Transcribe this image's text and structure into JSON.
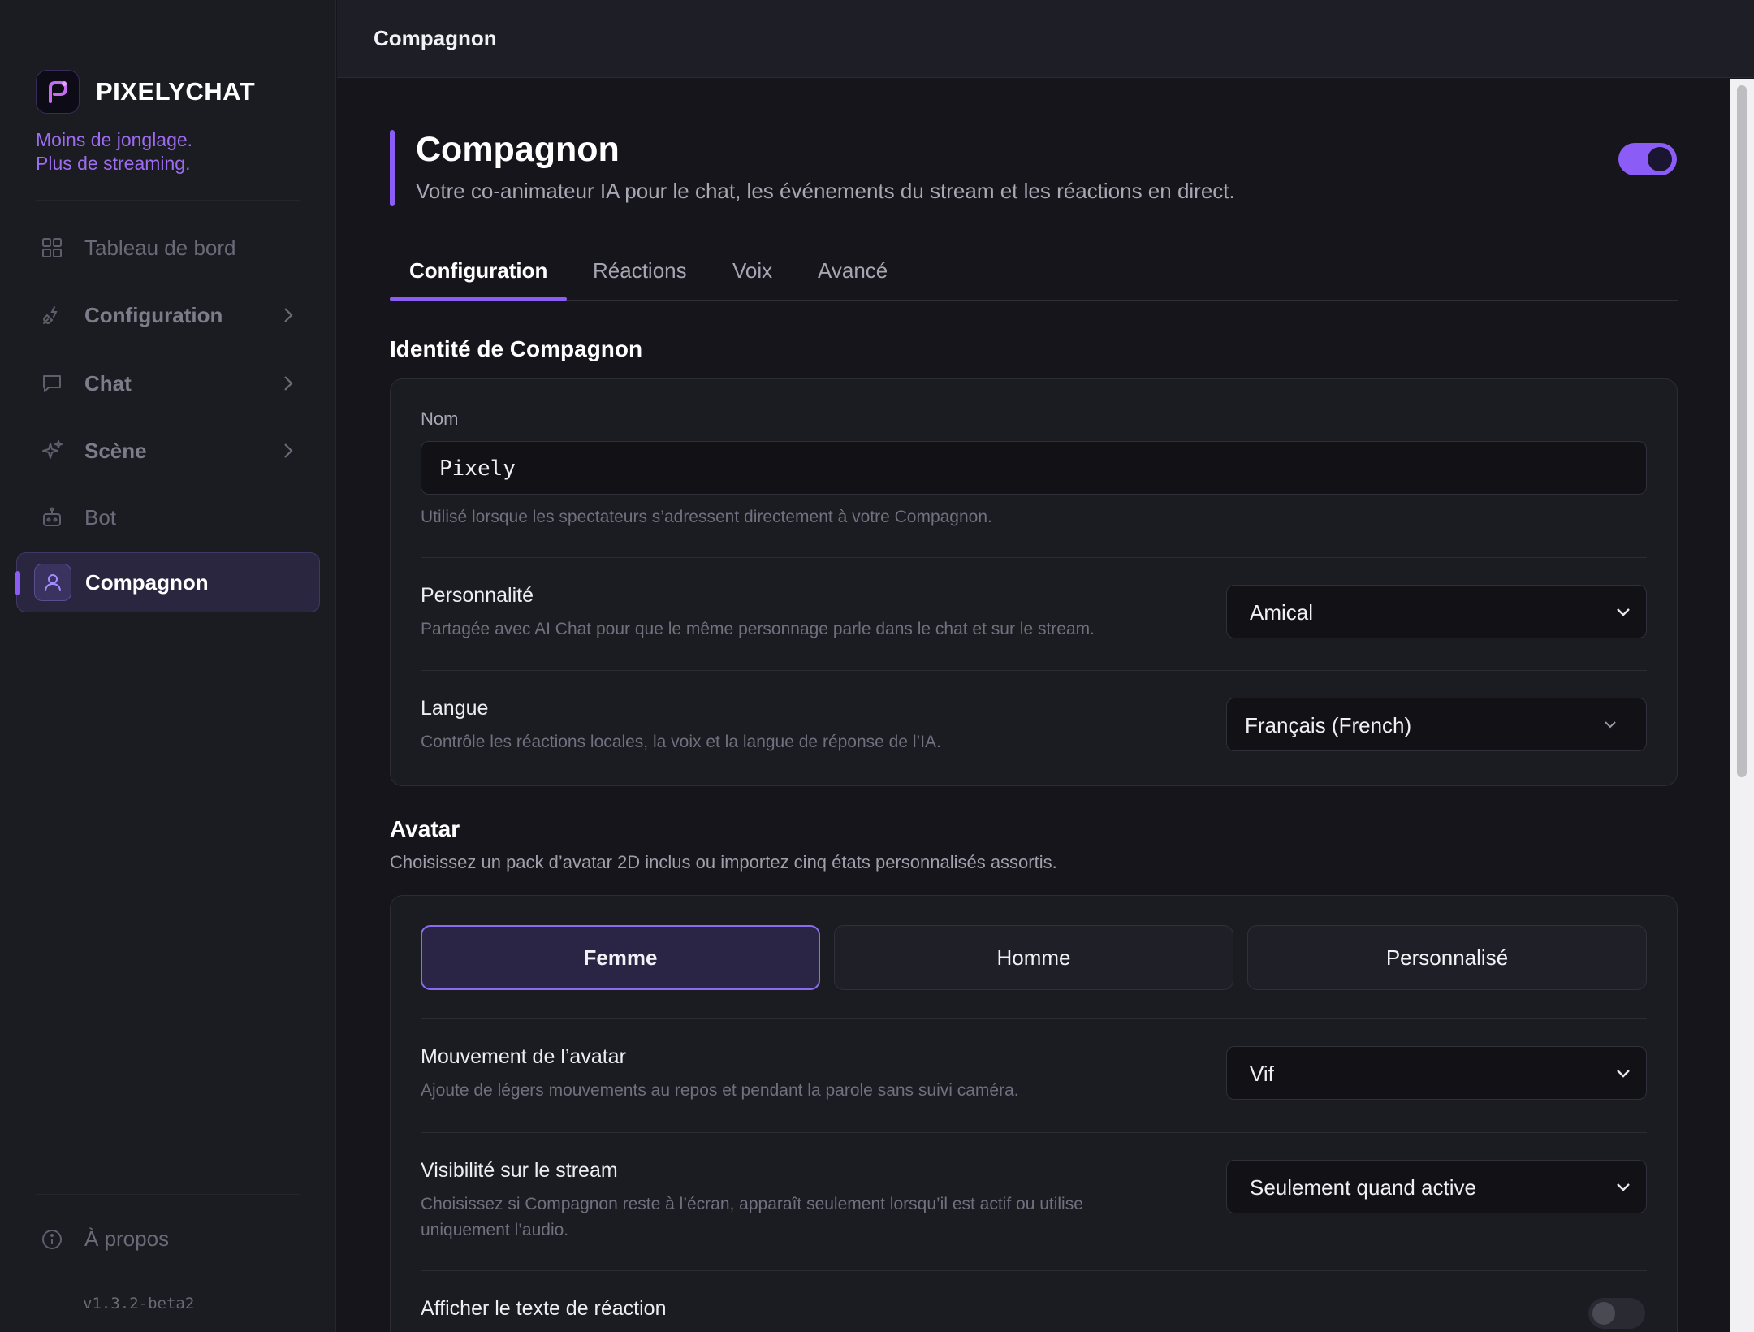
{
  "sidebar": {
    "brand": "PIXELYCHAT",
    "tagline_1": "Moins de jonglage.",
    "tagline_2": "Plus de streaming.",
    "items": [
      {
        "label": "Tableau de bord",
        "icon": "grid-icon"
      },
      {
        "label": "Configuration",
        "icon": "plug-icon",
        "has_children": true
      },
      {
        "label": "Chat",
        "icon": "chat-bubble-icon",
        "has_children": true
      },
      {
        "label": "Scène",
        "icon": "sparkle-icon",
        "has_children": true
      },
      {
        "label": "Bot",
        "icon": "robot-icon"
      },
      {
        "label": "Compagnon",
        "icon": "user-icon",
        "active": true
      }
    ],
    "about": "À propos",
    "version": "v1.3.2-beta2"
  },
  "topbar": {
    "title": "Compagnon"
  },
  "header": {
    "title": "Compagnon",
    "subtitle": "Votre co-animateur IA pour le chat, les événements du stream et les réactions en direct.",
    "enabled": true
  },
  "tabs": [
    {
      "label": "Configuration",
      "active": true
    },
    {
      "label": "Réactions"
    },
    {
      "label": "Voix"
    },
    {
      "label": "Avancé"
    }
  ],
  "identity": {
    "title": "Identité de Compagnon",
    "name_label": "Nom",
    "name_value": "Pixely",
    "name_help": "Utilisé lorsque les spectateurs s’adressent directement à votre Compagnon.",
    "personality_label": "Personnalité",
    "personality_help": "Partagée avec AI Chat pour que le même personnage parle dans le chat et sur le stream.",
    "personality_value": "Amical",
    "language_label": "Langue",
    "language_help": "Contrôle les réactions locales, la voix et la langue de réponse de l’IA.",
    "language_value": "Français (French)"
  },
  "avatar": {
    "title": "Avatar",
    "subtitle": "Choisissez un pack d’avatar 2D inclus ou importez cinq états personnalisés assortis.",
    "options": [
      {
        "label": "Femme",
        "active": true
      },
      {
        "label": "Homme"
      },
      {
        "label": "Personnalisé"
      }
    ],
    "movement_label": "Mouvement de l’avatar",
    "movement_help": "Ajoute de légers mouvements au repos et pendant la parole sans suivi caméra.",
    "movement_value": "Vif",
    "visibility_label": "Visibilité sur le stream",
    "visibility_help_1": "Choisissez si Compagnon reste à l’écran, apparaît seulement lorsqu’il est actif ou utilise",
    "visibility_help_2": "uniquement l’audio.",
    "visibility_value": "Seulement quand active",
    "reaction_text_label": "Afficher le texte de réaction",
    "reaction_text_enabled": false
  },
  "colors": {
    "accent": "#8b5cf6",
    "background": "#15151b",
    "sidebar": "#1b1b22"
  }
}
